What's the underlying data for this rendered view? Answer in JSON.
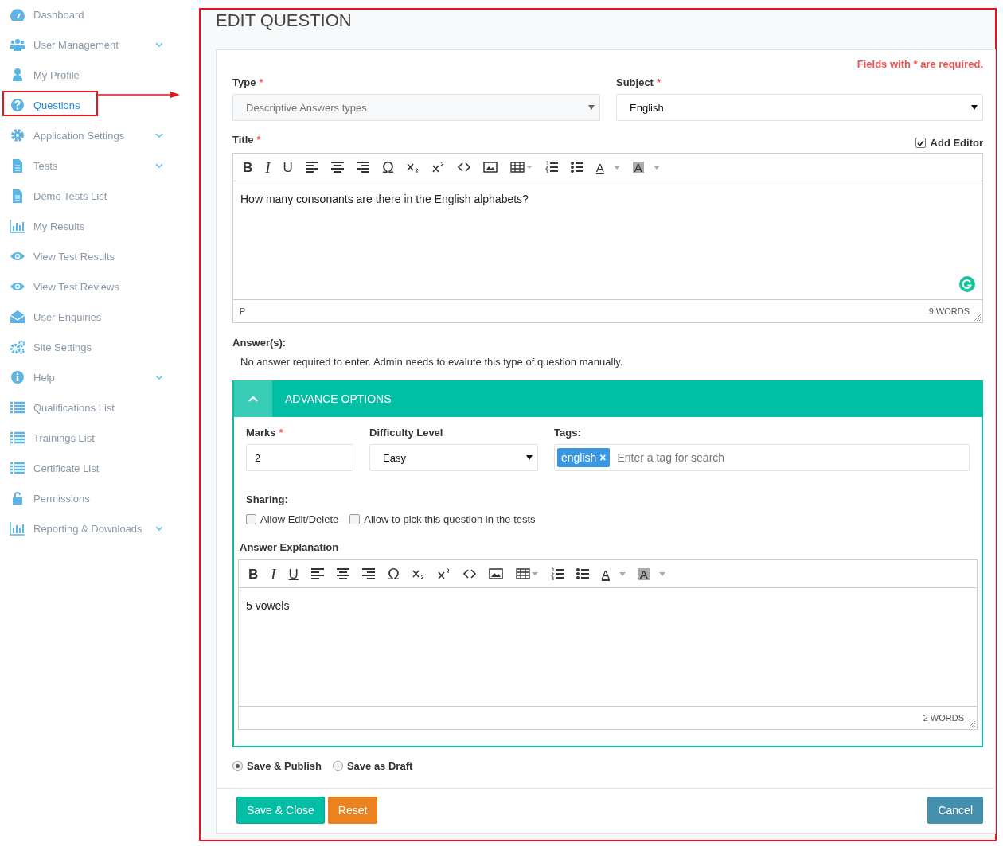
{
  "sidebar": {
    "items": [
      {
        "label": "Dashboard",
        "selected": false,
        "has_submenu": false
      },
      {
        "label": "User Management",
        "selected": false,
        "has_submenu": true
      },
      {
        "label": "My Profile",
        "selected": false,
        "has_submenu": false
      },
      {
        "label": "Questions",
        "selected": true,
        "has_submenu": false
      },
      {
        "label": "Application Settings",
        "selected": false,
        "has_submenu": true
      },
      {
        "label": "Tests",
        "selected": false,
        "has_submenu": true
      },
      {
        "label": "Demo Tests List",
        "selected": false,
        "has_submenu": false
      },
      {
        "label": "My Results",
        "selected": false,
        "has_submenu": false
      },
      {
        "label": "View Test Results",
        "selected": false,
        "has_submenu": false
      },
      {
        "label": "View Test Reviews",
        "selected": false,
        "has_submenu": false
      },
      {
        "label": "User Enquiries",
        "selected": false,
        "has_submenu": false
      },
      {
        "label": "Site Settings",
        "selected": false,
        "has_submenu": false
      },
      {
        "label": "Help",
        "selected": false,
        "has_submenu": true
      },
      {
        "label": "Qualifications List",
        "selected": false,
        "has_submenu": false
      },
      {
        "label": "Trainings List",
        "selected": false,
        "has_submenu": false
      },
      {
        "label": "Certificate List",
        "selected": false,
        "has_submenu": false
      },
      {
        "label": "Permissions",
        "selected": false,
        "has_submenu": false
      },
      {
        "label": "Reporting & Downloads",
        "selected": false,
        "has_submenu": true
      }
    ]
  },
  "page_title": "EDIT QUESTION",
  "required_note": "Fields with * are required.",
  "type_field": {
    "label": "Type",
    "required_mark": "*",
    "value": "Descriptive Answers types",
    "disabled": true
  },
  "subject_field": {
    "label": "Subject",
    "required_mark": "*",
    "value": "English",
    "disabled": false
  },
  "title_field": {
    "label": "Title",
    "required_mark": "*",
    "add_editor": {
      "label": "Add Editor",
      "checked": true
    },
    "toolbar": [
      {
        "kind": "bold",
        "text": "B"
      },
      {
        "kind": "italic",
        "text": "I"
      },
      {
        "kind": "underline",
        "text": "U"
      },
      {
        "kind": "align-left"
      },
      {
        "kind": "align-center"
      },
      {
        "kind": "align-right"
      },
      {
        "kind": "symbol",
        "text": "Ω"
      },
      {
        "kind": "subscript"
      },
      {
        "kind": "superscript"
      },
      {
        "kind": "code"
      },
      {
        "kind": "image"
      },
      {
        "kind": "table"
      },
      {
        "kind": "ordered-list"
      },
      {
        "kind": "bullet-list"
      },
      {
        "kind": "text-color",
        "text": "A"
      },
      {
        "kind": "background-color",
        "text": "A"
      }
    ],
    "content": "How many consonants are there in the English alphabets?",
    "path": "P",
    "word_count": "9 WORDS"
  },
  "answers": {
    "label": "Answer(s):",
    "note": "No answer required to enter. Admin needs to evalute this type of question manually."
  },
  "advance_options": {
    "title": "ADVANCE OPTIONS",
    "expanded": true,
    "marks": {
      "label": "Marks",
      "required_mark": "*",
      "value": "2"
    },
    "difficulty": {
      "label": "Difficulty Level",
      "value": "Easy"
    },
    "tags": {
      "label": "Tags:",
      "items": [
        {
          "label": "english",
          "remove": "×"
        }
      ],
      "placeholder": "Enter a tag for search"
    },
    "sharing": {
      "label": "Sharing:",
      "options": [
        {
          "label": "Allow Edit/Delete",
          "checked": false
        },
        {
          "label": "Allow to pick this question in the tests",
          "checked": false
        }
      ]
    },
    "explanation": {
      "label": "Answer Explanation",
      "toolbar": [
        {
          "kind": "bold",
          "text": "B"
        },
        {
          "kind": "italic",
          "text": "I"
        },
        {
          "kind": "underline",
          "text": "U"
        },
        {
          "kind": "align-left"
        },
        {
          "kind": "align-center"
        },
        {
          "kind": "align-right"
        },
        {
          "kind": "symbol",
          "text": "Ω"
        },
        {
          "kind": "subscript"
        },
        {
          "kind": "superscript"
        },
        {
          "kind": "code"
        },
        {
          "kind": "image"
        },
        {
          "kind": "table"
        },
        {
          "kind": "ordered-list"
        },
        {
          "kind": "bullet-list"
        },
        {
          "kind": "text-color",
          "text": "A"
        },
        {
          "kind": "background-color",
          "text": "A"
        }
      ],
      "content": "5 vowels",
      "word_count": "2 WORDS"
    }
  },
  "publish_options": [
    {
      "label": "Save & Publish",
      "selected": true
    },
    {
      "label": "Save as Draft",
      "selected": false
    }
  ],
  "buttons": [
    {
      "label": "Save & Close",
      "kind": "primary"
    },
    {
      "label": "Reset",
      "kind": "warning"
    },
    {
      "label": "Cancel",
      "kind": "cancel"
    }
  ]
}
